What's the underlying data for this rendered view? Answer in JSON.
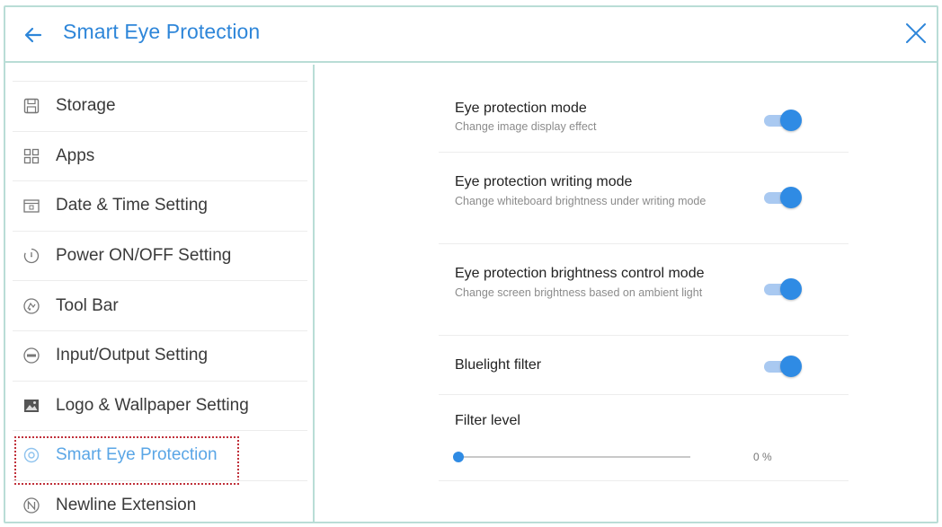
{
  "header": {
    "title": "Smart Eye Protection"
  },
  "sidebar": {
    "items": [
      {
        "label": "Storage",
        "icon": "storage-icon"
      },
      {
        "label": "Apps",
        "icon": "apps-grid-icon"
      },
      {
        "label": "Date & Time Setting",
        "icon": "calendar-icon"
      },
      {
        "label": "Power ON/OFF Setting",
        "icon": "power-timer-icon"
      },
      {
        "label": "Tool Bar",
        "icon": "toolbar-icon"
      },
      {
        "label": "Input/Output Setting",
        "icon": "input-output-icon"
      },
      {
        "label": "Logo & Wallpaper Setting",
        "icon": "image-icon"
      },
      {
        "label": "Smart Eye Protection",
        "icon": "eye-icon",
        "active": true
      },
      {
        "label": "Newline Extension",
        "icon": "newline-icon"
      }
    ]
  },
  "settings": [
    {
      "title": "Eye protection mode",
      "desc": "Change image display effect",
      "enabled": true
    },
    {
      "title": "Eye protection writing mode",
      "desc": "Change whiteboard brightness under writing mode",
      "enabled": true
    },
    {
      "title": "Eye protection brightness control mode",
      "desc": "Change screen brightness based on ambient light",
      "enabled": true
    },
    {
      "title": "Bluelight filter",
      "desc": "",
      "enabled": true
    }
  ],
  "filter": {
    "label": "Filter level",
    "value": 0,
    "value_text": "0 %"
  },
  "colors": {
    "accent": "#2f8be4",
    "title": "#2e86d9",
    "border": "#b9ddd6",
    "active_outline": "#c0303a"
  }
}
